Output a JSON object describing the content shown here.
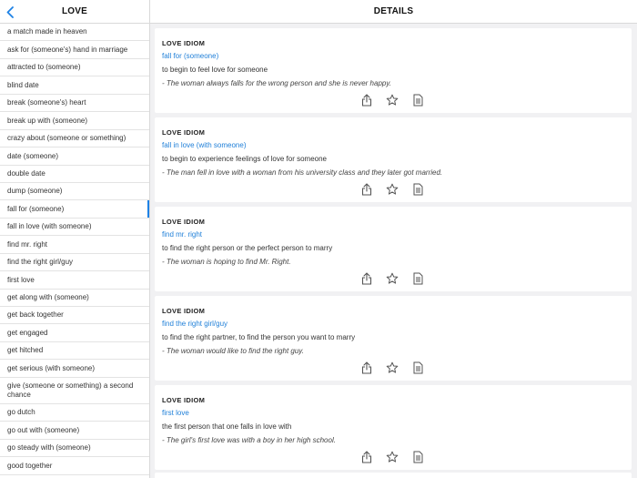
{
  "sidebar": {
    "title": "LOVE",
    "items": [
      {
        "label": "a match made in heaven"
      },
      {
        "label": "ask for (someone's) hand in marriage"
      },
      {
        "label": "attracted to (someone)"
      },
      {
        "label": "blind date"
      },
      {
        "label": "break (someone's) heart"
      },
      {
        "label": "break up with (someone)"
      },
      {
        "label": "crazy about (someone or something)"
      },
      {
        "label": "date (someone)"
      },
      {
        "label": "double date"
      },
      {
        "label": "dump (someone)"
      },
      {
        "label": "fall for (someone)",
        "active": true
      },
      {
        "label": "fall in love (with someone)"
      },
      {
        "label": "find mr. right"
      },
      {
        "label": "find the right girl/guy"
      },
      {
        "label": "first love"
      },
      {
        "label": "get along with (someone)"
      },
      {
        "label": "get back together"
      },
      {
        "label": "get engaged"
      },
      {
        "label": "get hitched"
      },
      {
        "label": "get serious (with someone)"
      },
      {
        "label": "give (someone or something) a second chance"
      },
      {
        "label": "go dutch"
      },
      {
        "label": "go out with (someone)"
      },
      {
        "label": "go steady with (someone)"
      },
      {
        "label": "good together"
      }
    ]
  },
  "detail": {
    "title": "DETAILS",
    "cards": [
      {
        "kicker": "LOVE IDIOM",
        "term": "fall for (someone)",
        "definition": "to begin to feel love for someone",
        "example": "- The woman always falls for the wrong person and she is never happy."
      },
      {
        "kicker": "LOVE IDIOM",
        "term": "fall in love (with someone)",
        "definition": "to begin to experience feelings of love for someone",
        "example": "- The man fell in love with a woman from his university class and they later got married."
      },
      {
        "kicker": "LOVE IDIOM",
        "term": "find mr. right",
        "definition": "to find the right person or the perfect person to marry",
        "example": "- The woman is hoping to find Mr. Right."
      },
      {
        "kicker": "LOVE IDIOM",
        "term": "find the right girl/guy",
        "definition": "to find the right partner, to find the person you want to marry",
        "example": "- The woman would like to find the right guy."
      },
      {
        "kicker": "LOVE IDIOM",
        "term": "first love",
        "definition": "the first person that one falls in love with",
        "example": "- The girl's first love was with a boy in her high school."
      }
    ]
  },
  "colors": {
    "accent": "#1e82e6",
    "link": "#1f7fd8",
    "pane_background": "#f1f1f3"
  },
  "icons": {
    "back": "chevron-left-icon",
    "share": "share-icon",
    "favorite": "star-icon",
    "notes": "document-icon"
  }
}
